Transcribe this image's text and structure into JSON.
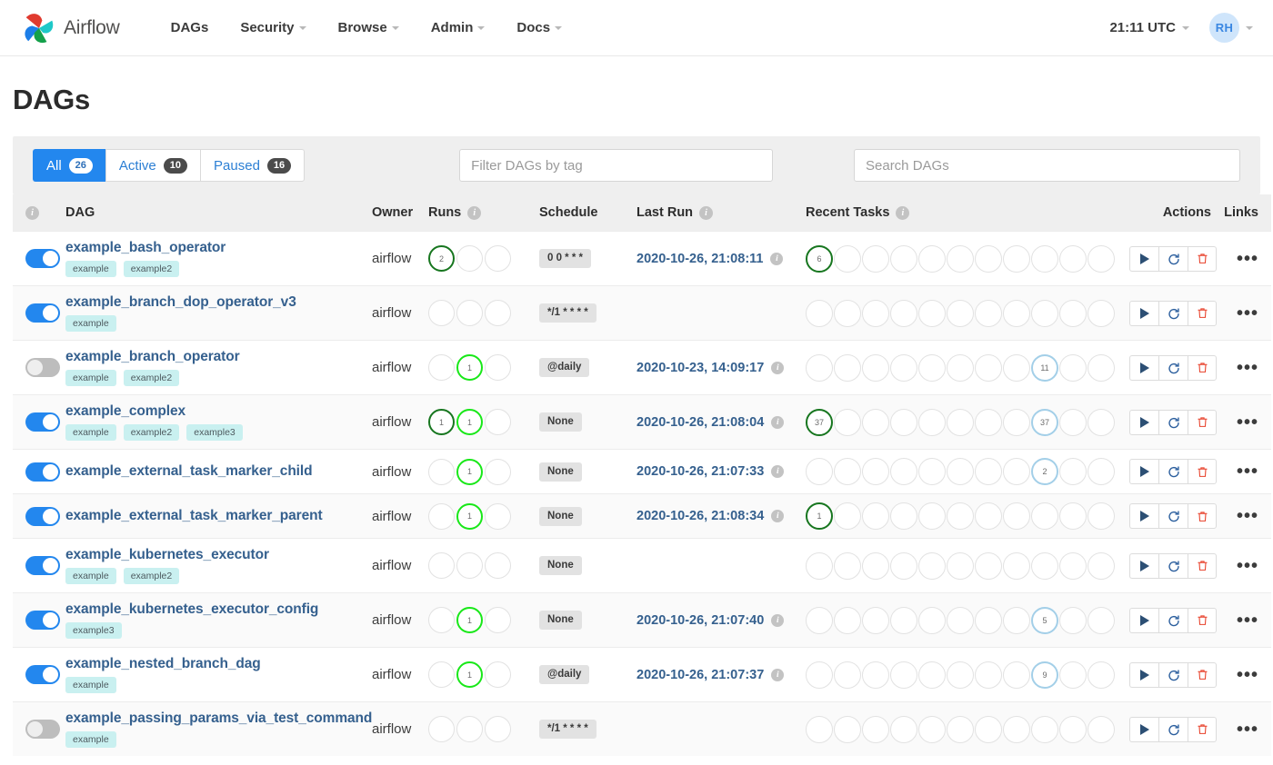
{
  "navbar": {
    "brand": "Airflow",
    "logo_icon": "airflow-pinwheel-logo",
    "menu": [
      {
        "label": "DAGs",
        "has_caret": false
      },
      {
        "label": "Security",
        "has_caret": true
      },
      {
        "label": "Browse",
        "has_caret": true
      },
      {
        "label": "Admin",
        "has_caret": true
      },
      {
        "label": "Docs",
        "has_caret": true
      }
    ],
    "clock": "21:11 UTC",
    "avatar_initials": "RH"
  },
  "page": {
    "title": "DAGs"
  },
  "filters": {
    "tabs": [
      {
        "label": "All",
        "count": "26",
        "active": true
      },
      {
        "label": "Active",
        "count": "10",
        "active": false
      },
      {
        "label": "Paused",
        "count": "16",
        "active": false
      }
    ],
    "tag_placeholder": "Filter DAGs by tag",
    "tag_value": "",
    "search_placeholder": "Search DAGs",
    "search_value": ""
  },
  "table": {
    "headers": {
      "toggle_info": "i",
      "dag": "DAG",
      "owner": "Owner",
      "runs": "Runs",
      "runs_info": "i",
      "schedule": "Schedule",
      "last_run": "Last Run",
      "last_run_info": "i",
      "recent_tasks": "Recent Tasks",
      "recent_tasks_info": "i",
      "actions": "Actions",
      "links": "Links"
    },
    "action_icons": [
      "trigger-play-icon",
      "refresh-icon",
      "delete-trash-icon"
    ],
    "links_label": "•••",
    "rows": [
      {
        "name": "example_bash_operator",
        "paused": false,
        "tags": [
          "example",
          "example2"
        ],
        "owner": "airflow",
        "runs": [
          {
            "state": "success",
            "count": "2"
          },
          {
            "state": "none",
            "count": ""
          },
          {
            "state": "none",
            "count": ""
          }
        ],
        "schedule": "0 0 * * *",
        "last_run": "2020-10-26, 21:08:11",
        "recent_tasks": [
          {
            "state": "success",
            "count": "6"
          },
          {
            "state": "none",
            "count": ""
          },
          {
            "state": "none",
            "count": ""
          },
          {
            "state": "none",
            "count": ""
          },
          {
            "state": "none",
            "count": ""
          },
          {
            "state": "none",
            "count": ""
          },
          {
            "state": "none",
            "count": ""
          },
          {
            "state": "none",
            "count": ""
          },
          {
            "state": "none",
            "count": ""
          },
          {
            "state": "none",
            "count": ""
          },
          {
            "state": "none",
            "count": ""
          }
        ]
      },
      {
        "name": "example_branch_dop_operator_v3",
        "paused": false,
        "tags": [
          "example"
        ],
        "owner": "airflow",
        "runs": [
          {
            "state": "none",
            "count": ""
          },
          {
            "state": "none",
            "count": ""
          },
          {
            "state": "none",
            "count": ""
          }
        ],
        "schedule": "*/1 * * * *",
        "last_run": "",
        "recent_tasks": [
          {
            "state": "none",
            "count": ""
          },
          {
            "state": "none",
            "count": ""
          },
          {
            "state": "none",
            "count": ""
          },
          {
            "state": "none",
            "count": ""
          },
          {
            "state": "none",
            "count": ""
          },
          {
            "state": "none",
            "count": ""
          },
          {
            "state": "none",
            "count": ""
          },
          {
            "state": "none",
            "count": ""
          },
          {
            "state": "none",
            "count": ""
          },
          {
            "state": "none",
            "count": ""
          },
          {
            "state": "none",
            "count": ""
          }
        ]
      },
      {
        "name": "example_branch_operator",
        "paused": true,
        "tags": [
          "example",
          "example2"
        ],
        "owner": "airflow",
        "runs": [
          {
            "state": "none",
            "count": ""
          },
          {
            "state": "running",
            "count": "1"
          },
          {
            "state": "none",
            "count": ""
          }
        ],
        "schedule": "@daily",
        "last_run": "2020-10-23, 14:09:17",
        "recent_tasks": [
          {
            "state": "none",
            "count": ""
          },
          {
            "state": "none",
            "count": ""
          },
          {
            "state": "none",
            "count": ""
          },
          {
            "state": "none",
            "count": ""
          },
          {
            "state": "none",
            "count": ""
          },
          {
            "state": "none",
            "count": ""
          },
          {
            "state": "none",
            "count": ""
          },
          {
            "state": "none",
            "count": ""
          },
          {
            "state": "scheduled",
            "count": "11"
          },
          {
            "state": "none",
            "count": ""
          },
          {
            "state": "none",
            "count": ""
          }
        ]
      },
      {
        "name": "example_complex",
        "paused": false,
        "tags": [
          "example",
          "example2",
          "example3"
        ],
        "owner": "airflow",
        "runs": [
          {
            "state": "success",
            "count": "1"
          },
          {
            "state": "running",
            "count": "1"
          },
          {
            "state": "none",
            "count": ""
          }
        ],
        "schedule": "None",
        "last_run": "2020-10-26, 21:08:04",
        "recent_tasks": [
          {
            "state": "success",
            "count": "37"
          },
          {
            "state": "none",
            "count": ""
          },
          {
            "state": "none",
            "count": ""
          },
          {
            "state": "none",
            "count": ""
          },
          {
            "state": "none",
            "count": ""
          },
          {
            "state": "none",
            "count": ""
          },
          {
            "state": "none",
            "count": ""
          },
          {
            "state": "none",
            "count": ""
          },
          {
            "state": "scheduled",
            "count": "37"
          },
          {
            "state": "none",
            "count": ""
          },
          {
            "state": "none",
            "count": ""
          }
        ]
      },
      {
        "name": "example_external_task_marker_child",
        "paused": false,
        "tags": [],
        "owner": "airflow",
        "runs": [
          {
            "state": "none",
            "count": ""
          },
          {
            "state": "running",
            "count": "1"
          },
          {
            "state": "none",
            "count": ""
          }
        ],
        "schedule": "None",
        "last_run": "2020-10-26, 21:07:33",
        "recent_tasks": [
          {
            "state": "none",
            "count": ""
          },
          {
            "state": "none",
            "count": ""
          },
          {
            "state": "none",
            "count": ""
          },
          {
            "state": "none",
            "count": ""
          },
          {
            "state": "none",
            "count": ""
          },
          {
            "state": "none",
            "count": ""
          },
          {
            "state": "none",
            "count": ""
          },
          {
            "state": "none",
            "count": ""
          },
          {
            "state": "scheduled",
            "count": "2"
          },
          {
            "state": "none",
            "count": ""
          },
          {
            "state": "none",
            "count": ""
          }
        ]
      },
      {
        "name": "example_external_task_marker_parent",
        "paused": false,
        "tags": [],
        "owner": "airflow",
        "runs": [
          {
            "state": "none",
            "count": ""
          },
          {
            "state": "running",
            "count": "1"
          },
          {
            "state": "none",
            "count": ""
          }
        ],
        "schedule": "None",
        "last_run": "2020-10-26, 21:08:34",
        "recent_tasks": [
          {
            "state": "success",
            "count": "1"
          },
          {
            "state": "none",
            "count": ""
          },
          {
            "state": "none",
            "count": ""
          },
          {
            "state": "none",
            "count": ""
          },
          {
            "state": "none",
            "count": ""
          },
          {
            "state": "none",
            "count": ""
          },
          {
            "state": "none",
            "count": ""
          },
          {
            "state": "none",
            "count": ""
          },
          {
            "state": "none",
            "count": ""
          },
          {
            "state": "none",
            "count": ""
          },
          {
            "state": "none",
            "count": ""
          }
        ]
      },
      {
        "name": "example_kubernetes_executor",
        "paused": false,
        "tags": [
          "example",
          "example2"
        ],
        "owner": "airflow",
        "runs": [
          {
            "state": "none",
            "count": ""
          },
          {
            "state": "none",
            "count": ""
          },
          {
            "state": "none",
            "count": ""
          }
        ],
        "schedule": "None",
        "last_run": "",
        "recent_tasks": [
          {
            "state": "none",
            "count": ""
          },
          {
            "state": "none",
            "count": ""
          },
          {
            "state": "none",
            "count": ""
          },
          {
            "state": "none",
            "count": ""
          },
          {
            "state": "none",
            "count": ""
          },
          {
            "state": "none",
            "count": ""
          },
          {
            "state": "none",
            "count": ""
          },
          {
            "state": "none",
            "count": ""
          },
          {
            "state": "none",
            "count": ""
          },
          {
            "state": "none",
            "count": ""
          },
          {
            "state": "none",
            "count": ""
          }
        ]
      },
      {
        "name": "example_kubernetes_executor_config",
        "paused": false,
        "tags": [
          "example3"
        ],
        "owner": "airflow",
        "runs": [
          {
            "state": "none",
            "count": ""
          },
          {
            "state": "running",
            "count": "1"
          },
          {
            "state": "none",
            "count": ""
          }
        ],
        "schedule": "None",
        "last_run": "2020-10-26, 21:07:40",
        "recent_tasks": [
          {
            "state": "none",
            "count": ""
          },
          {
            "state": "none",
            "count": ""
          },
          {
            "state": "none",
            "count": ""
          },
          {
            "state": "none",
            "count": ""
          },
          {
            "state": "none",
            "count": ""
          },
          {
            "state": "none",
            "count": ""
          },
          {
            "state": "none",
            "count": ""
          },
          {
            "state": "none",
            "count": ""
          },
          {
            "state": "scheduled",
            "count": "5"
          },
          {
            "state": "none",
            "count": ""
          },
          {
            "state": "none",
            "count": ""
          }
        ]
      },
      {
        "name": "example_nested_branch_dag",
        "paused": false,
        "tags": [
          "example"
        ],
        "owner": "airflow",
        "runs": [
          {
            "state": "none",
            "count": ""
          },
          {
            "state": "running",
            "count": "1"
          },
          {
            "state": "none",
            "count": ""
          }
        ],
        "schedule": "@daily",
        "last_run": "2020-10-26, 21:07:37",
        "recent_tasks": [
          {
            "state": "none",
            "count": ""
          },
          {
            "state": "none",
            "count": ""
          },
          {
            "state": "none",
            "count": ""
          },
          {
            "state": "none",
            "count": ""
          },
          {
            "state": "none",
            "count": ""
          },
          {
            "state": "none",
            "count": ""
          },
          {
            "state": "none",
            "count": ""
          },
          {
            "state": "none",
            "count": ""
          },
          {
            "state": "scheduled",
            "count": "9"
          },
          {
            "state": "none",
            "count": ""
          },
          {
            "state": "none",
            "count": ""
          }
        ]
      },
      {
        "name": "example_passing_params_via_test_command",
        "paused": true,
        "tags": [
          "example"
        ],
        "owner": "airflow",
        "runs": [
          {
            "state": "none",
            "count": ""
          },
          {
            "state": "none",
            "count": ""
          },
          {
            "state": "none",
            "count": ""
          }
        ],
        "schedule": "*/1 * * * *",
        "last_run": "",
        "recent_tasks": [
          {
            "state": "none",
            "count": ""
          },
          {
            "state": "none",
            "count": ""
          },
          {
            "state": "none",
            "count": ""
          },
          {
            "state": "none",
            "count": ""
          },
          {
            "state": "none",
            "count": ""
          },
          {
            "state": "none",
            "count": ""
          },
          {
            "state": "none",
            "count": ""
          },
          {
            "state": "none",
            "count": ""
          },
          {
            "state": "none",
            "count": ""
          },
          {
            "state": "none",
            "count": ""
          },
          {
            "state": "none",
            "count": ""
          }
        ]
      }
    ]
  },
  "colors": {
    "accent": "#2387ee",
    "link": "#35608e",
    "success": "#17761f",
    "running": "#19e819",
    "scheduled": "#a3cfe8",
    "delete": "#e8402a",
    "tag_bg": "#c9f0f0"
  }
}
